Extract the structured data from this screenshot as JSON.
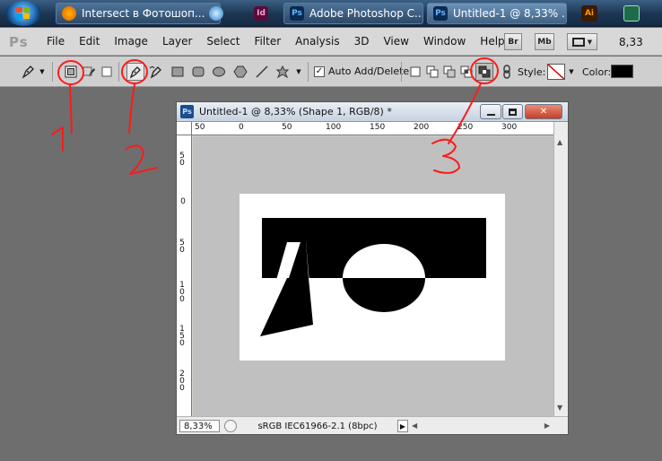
{
  "taskbar": {
    "tasks": [
      {
        "label": "Intersect в Фотошоп...",
        "icon": "firefox-icon"
      },
      {
        "label": "",
        "icon": "globe-icon"
      },
      {
        "label": "",
        "icon": "indesign-icon",
        "text": "Id"
      },
      {
        "label": "Adobe Photoshop C...",
        "icon": "photoshop-icon",
        "text": "Ps"
      },
      {
        "label": "Untitled-1 @ 8,33% ...",
        "icon": "photoshop-icon",
        "text": "Ps"
      }
    ],
    "tray": [
      {
        "text": "Ai"
      },
      {
        "text": ""
      }
    ]
  },
  "menubar": {
    "logo": "Ps",
    "items": [
      "File",
      "Edit",
      "Image",
      "Layer",
      "Select",
      "Filter",
      "Analysis",
      "3D",
      "View",
      "Window",
      "Help"
    ],
    "bridge": "Br",
    "minibridge": "Mb",
    "zoom": "8,33"
  },
  "options": {
    "auto_add_delete": "Auto Add/Delete",
    "auto_add_checked": "✓",
    "style_label": "Style:",
    "color_label": "Color:",
    "color_value": "#000000"
  },
  "document": {
    "title": "Untitled-1 @ 8,33% (Shape 1, RGB/8) *",
    "icon_text": "Ps",
    "ruler_top": [
      "50",
      "0",
      "50",
      "100",
      "150",
      "200",
      "250",
      "300"
    ],
    "ruler_left": [
      "5 0",
      "0",
      "5 0",
      "1 0 0",
      "1 5 0",
      "2 0 0"
    ],
    "zoom": "8,33%",
    "status": "sRGB IEC61966-2.1 (8bpc)"
  },
  "annotations": [
    "1",
    "2",
    "3"
  ],
  "colors": {
    "accent": "#ff0000",
    "canvas": "#ffffff",
    "pasteboard": "#c0c0c0"
  }
}
